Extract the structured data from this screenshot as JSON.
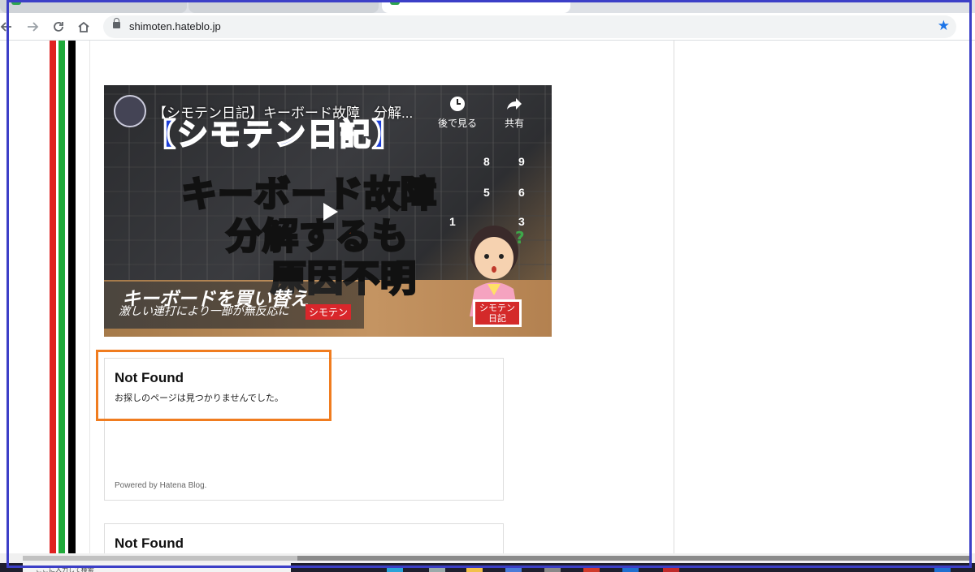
{
  "browser": {
    "url": "shimoten.hateblo.jp",
    "nav_icons": [
      "back-arrow-icon",
      "forward-arrow-icon",
      "reload-icon",
      "home-icon"
    ],
    "bookmark_icon": "star-icon",
    "accent": "#1a73e8"
  },
  "video": {
    "title": "【シモテン日記】キーボード故障　分解...",
    "watch_later": "後で見る",
    "share": "共有",
    "thumb_heading": "【シモテン日記】",
    "thumb_line1": "キーボード故障",
    "thumb_line2": "分解するも",
    "thumb_line3": "原因不明",
    "banner_main": "キーボードを買い替え",
    "banner_sub": "激しい連打により一部が無反応に",
    "banner_tag": "シモテン",
    "sign_line1": "シモテン",
    "sign_line2": "日記"
  },
  "cards": [
    {
      "title": "Not Found",
      "message": "お探しのページは見つかりませんでした。",
      "powered": "Powered by Hatena Blog."
    },
    {
      "title": "Not Found"
    }
  ],
  "taskbar": {
    "search_placeholder": "ここに入力して検索"
  },
  "colors": {
    "frame": "#3c3fc7",
    "highlight": "#f07c1f",
    "stripe_red": "#e02020",
    "stripe_green": "#1faa3a"
  }
}
